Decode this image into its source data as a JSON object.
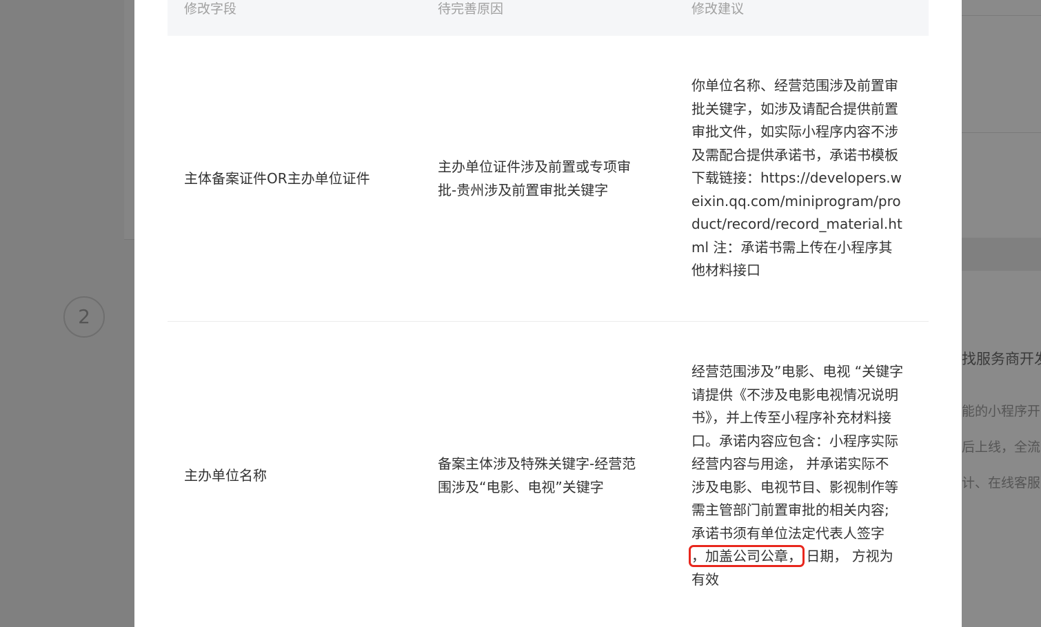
{
  "background": {
    "step_number": "2",
    "right_title": "找服务商开发",
    "right_lines": [
      "能的小程序开",
      "后上线，全流",
      "计、在线客服"
    ]
  },
  "table": {
    "headers": [
      "修改字段",
      "待完善原因",
      "修改建议"
    ],
    "rows": [
      {
        "field": "主体备案证件OR主办单位证件",
        "reason_lines": [
          "主办单位证件涉及前置或专项审",
          "批-贵州涉及前置审批关键字"
        ],
        "suggestion_lines": [
          "你单位名称、经营范围涉及前置审",
          "批关键字，如涉及请配合提供前置",
          "审批文件，如实际小程序内容不涉",
          "及需配合提供承诺书，承诺书模板",
          "下载链接：https://developers.w",
          "eixin.qq.com/miniprogram/pro",
          "duct/record/record_material.ht",
          "ml 注：承诺书需上传在小程序其",
          "他材料接口"
        ]
      },
      {
        "field": "主办单位名称",
        "reason_lines": [
          "备案主体涉及特殊关键字-经营范",
          "围涉及“电影、电视”关键字"
        ],
        "suggestion_lines": [
          "经营范围涉及”电影、电视 “关键字",
          "请提供《不涉及电影电视情况说明",
          "书》，并上传至小程序补充材料接",
          "口。承诺内容应包含：小程序实际",
          "经营内容与用途， 并承诺实际不",
          "涉及电影、电视节目、影视制作等",
          "需主管部门前置审批的相关内容;",
          "承诺书须有单位法定代表人签字"
        ],
        "suggestion_highlight": "，加盖公司公章，",
        "suggestion_after_highlight": "日期， 方视为",
        "suggestion_last_line": "有效"
      }
    ]
  },
  "colors": {
    "highlight_border": "#e8271d",
    "header_bg": "#f5f6f8",
    "overlay": "#808080"
  }
}
